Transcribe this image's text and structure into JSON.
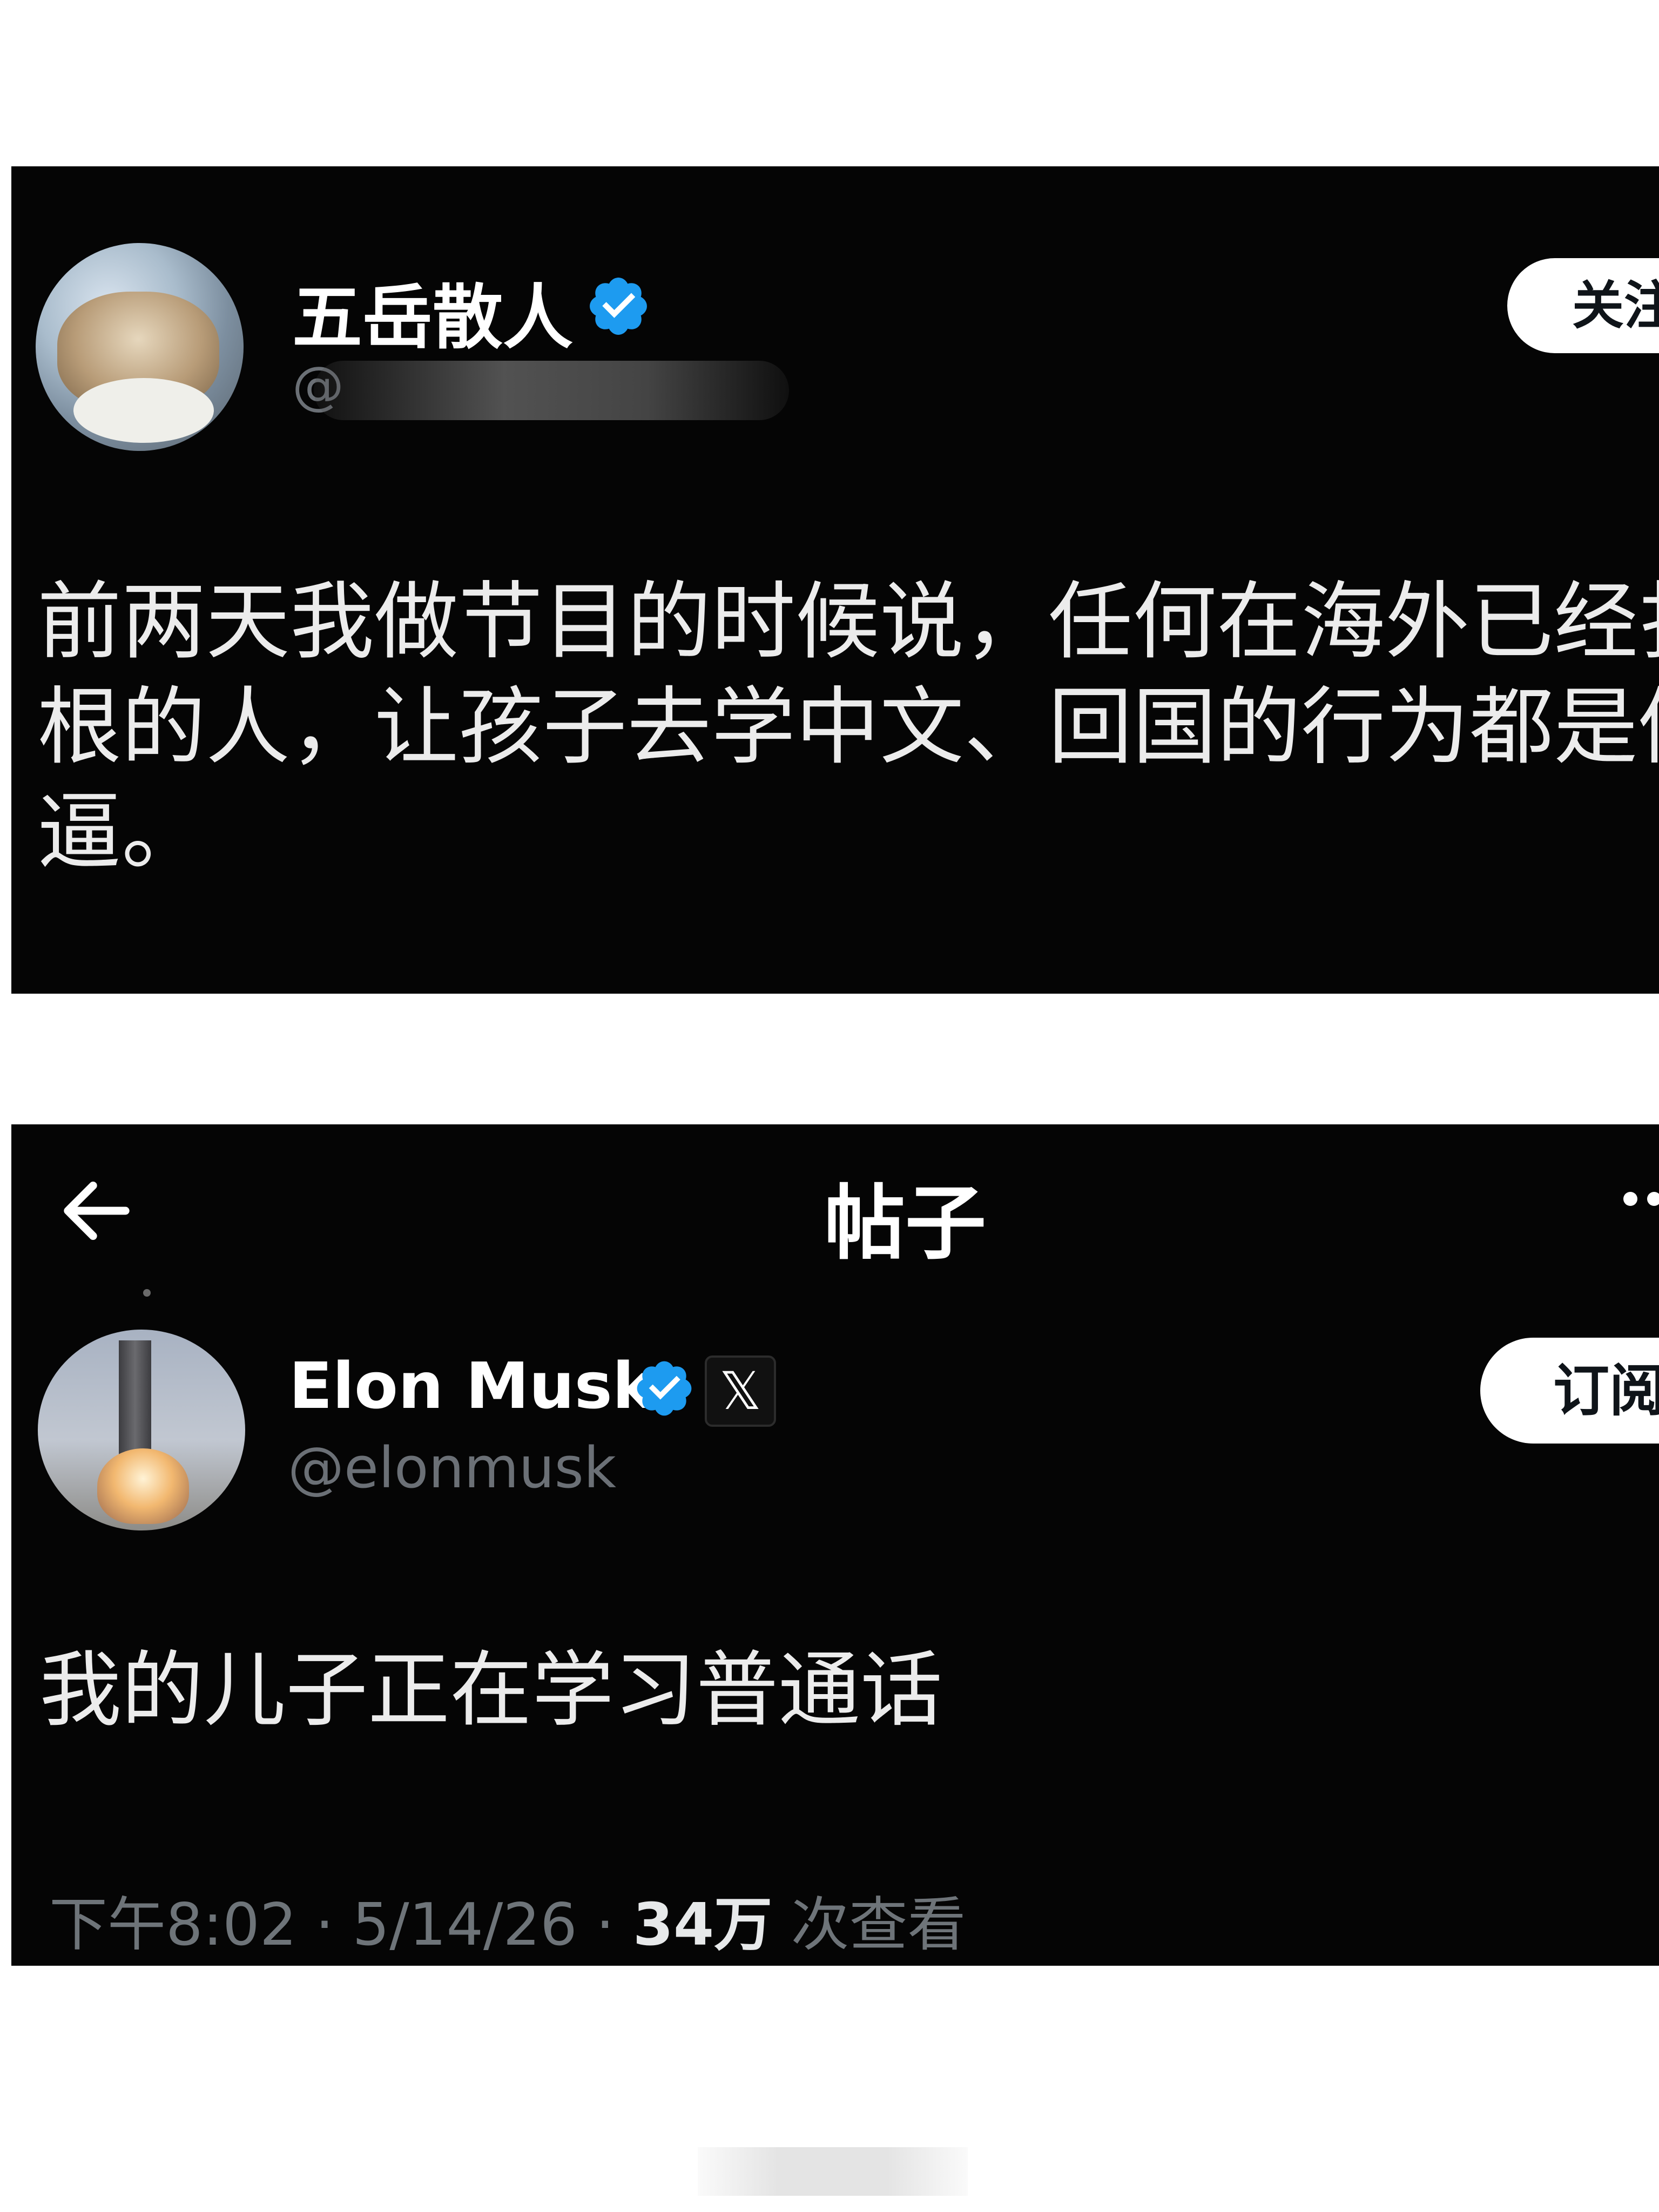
{
  "post1": {
    "author_name": "五岳散人",
    "handle_visible": "@",
    "follow_label": "关注",
    "text_lines": [
      "前两天我做节目的时候说，任何在海外已经扎下",
      "根的人，让孩子去学中文、回国的行为都是傻",
      "逼。"
    ]
  },
  "post2": {
    "topbar": {
      "back_icon": "arrow-left-icon",
      "title": "帖子",
      "more_icon": "more-icon"
    },
    "author_name": "Elon Musk",
    "handle": "@elonmusk",
    "subscribe_label": "订阅",
    "text": "我的儿子正在学习普通话",
    "meta": {
      "time": "下午8:02",
      "separator": " · ",
      "date": "5/14/26",
      "views_count": "34万",
      "views_label": " 次查看"
    }
  },
  "colors": {
    "panel_background": "#050505",
    "verified_blue": "#1d9bf0",
    "handle_gray": "#6b7076",
    "button_white": "#ffffff"
  }
}
